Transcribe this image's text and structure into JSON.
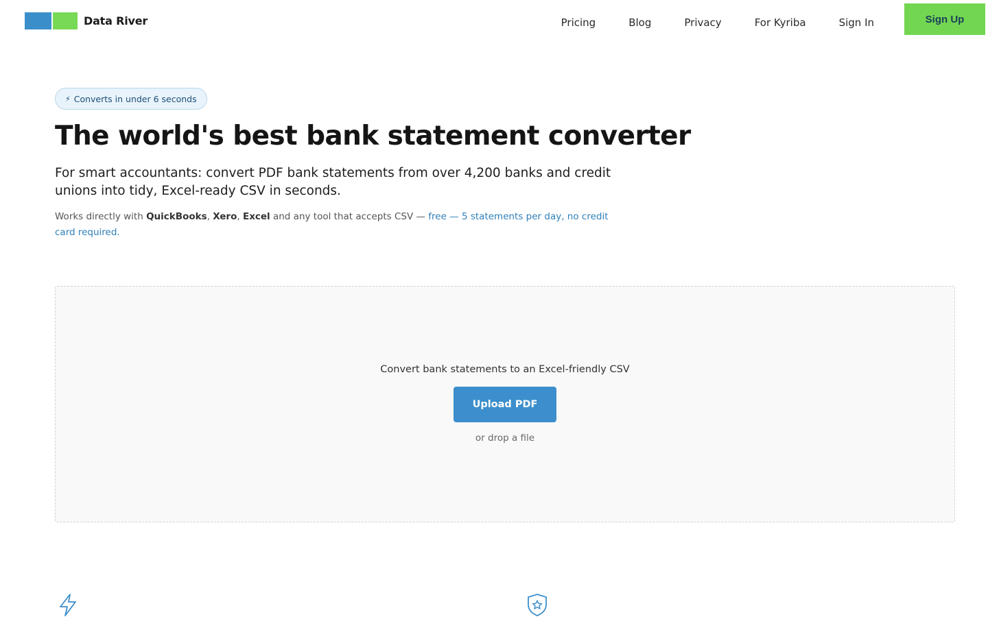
{
  "brand": {
    "name": "Data River",
    "logo_colors": [
      "#3a8fcb",
      "#78d955"
    ]
  },
  "nav": {
    "items": [
      "Pricing",
      "Blog",
      "Privacy",
      "For Kyriba",
      "Sign In"
    ],
    "signup_label": "Sign Up"
  },
  "hero": {
    "badge": "Converts in under 6 seconds",
    "badge_icon": "lightning-icon",
    "title": "The world's best bank statement converter",
    "subtitle": "For smart accountants: convert PDF bank statements from over 4,200 banks and credit unions into tidy, Excel-ready CSV in seconds.",
    "note": {
      "prefix": "Works directly with ",
      "tool1": "QuickBooks",
      "sep1": ", ",
      "tool2": "Xero",
      "sep2": ", ",
      "tool3": "Excel",
      "middle": " and any tool that accepts CSV — ",
      "free_text": "free — 5 statements per day, no credit card required."
    }
  },
  "upload": {
    "title": "Convert bank statements to an Excel-friendly CSV",
    "button_label": "Upload PDF",
    "hint": "or drop a file"
  },
  "features": {
    "icons": [
      "lightning-icon",
      "shield-star-icon"
    ]
  },
  "colors": {
    "accent_blue": "#3c8fcc",
    "accent_green": "#73d651",
    "link_blue": "#2f7fb8"
  }
}
